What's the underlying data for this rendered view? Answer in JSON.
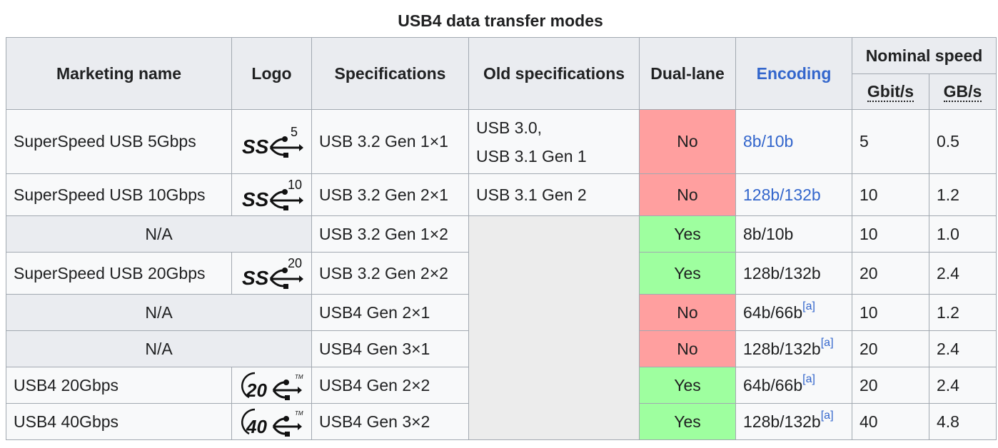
{
  "caption": "USB4 data transfer modes",
  "headers": {
    "marketing_name": "Marketing name",
    "logo": "Logo",
    "specifications": "Specifications",
    "old_specifications": "Old specifications",
    "dual_lane": "Dual-lane",
    "encoding": "Encoding",
    "nominal_speed": "Nominal speed",
    "gbits": "Gbit/s",
    "gbytes": "GB/s"
  },
  "colors": {
    "no": "#ff9f9f",
    "yes": "#9eff9f",
    "link": "#3366cc"
  },
  "rows": [
    {
      "name": "SuperSpeed USB 5Gbps",
      "logo": "superspeed-5-logo",
      "logo_num": "5",
      "spec": "USB 3.2 Gen 1×1",
      "old1": "USB 3.0,",
      "old2": "USB 3.1 Gen 1",
      "dual": "No",
      "enc": "8b/10b",
      "gbit": "5",
      "gb": "0.5"
    },
    {
      "name": "SuperSpeed USB 10Gbps",
      "logo": "superspeed-10-logo",
      "logo_num": "10",
      "spec": "USB 3.2 Gen 2×1",
      "old1": "USB 3.1 Gen 2",
      "dual": "No",
      "enc": "128b/132b",
      "gbit": "10",
      "gb": "1.2"
    },
    {
      "name": "N/A",
      "spec": "USB 3.2 Gen 1×2",
      "dual": "Yes",
      "enc": "8b/10b",
      "gbit": "10",
      "gb": "1.0"
    },
    {
      "name": "SuperSpeed USB 20Gbps",
      "logo": "superspeed-20-logo",
      "logo_num": "20",
      "spec": "USB 3.2 Gen 2×2",
      "dual": "Yes",
      "enc": "128b/132b",
      "gbit": "20",
      "gb": "2.4"
    },
    {
      "name": "N/A",
      "spec": "USB4 Gen 2×1",
      "dual": "No",
      "enc": "64b/66b",
      "note": "[a]",
      "gbit": "10",
      "gb": "1.2"
    },
    {
      "name": "N/A",
      "spec": "USB4 Gen 3×1",
      "dual": "No",
      "enc": "128b/132b",
      "note": "[a]",
      "gbit": "20",
      "gb": "2.4"
    },
    {
      "name": "USB4 20Gbps",
      "logo": "usb4-20-logo",
      "logo_num": "20",
      "spec": "USB4 Gen 2×2",
      "dual": "Yes",
      "enc": "64b/66b",
      "note": "[a]",
      "gbit": "20",
      "gb": "2.4"
    },
    {
      "name": "USB4 40Gbps",
      "logo": "usb4-40-logo",
      "logo_num": "40",
      "spec": "USB4 Gen 3×2",
      "dual": "Yes",
      "enc": "128b/132b",
      "note": "[a]",
      "gbit": "40",
      "gb": "4.8"
    }
  ],
  "logo_tm": "TM",
  "logo_ss": "SS"
}
